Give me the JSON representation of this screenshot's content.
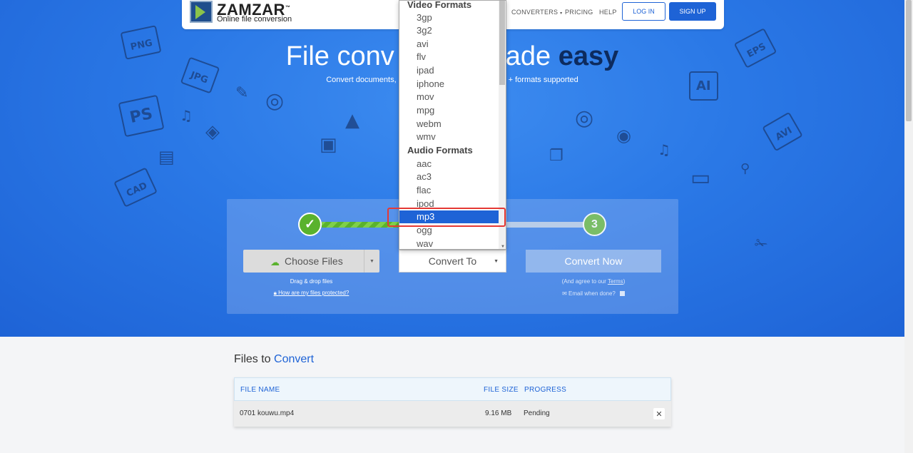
{
  "nav": {
    "logo_name": "ZAMZAR",
    "logo_tm": "™",
    "logo_tagline": "Online file conversion",
    "converters": "CONVERTERS",
    "pricing": "PRICING",
    "help": "HELP",
    "login": "LOG IN",
    "signup": "SIGN UP"
  },
  "hero": {
    "headline_start": "File conv",
    "headline_mid": "ade ",
    "headline_bold": "easy",
    "sub_left": "Convert documents,",
    "sub_right": "+ formats supported"
  },
  "doodles": [
    "PNG",
    "JPG",
    "PS",
    "CAD",
    "EPS",
    "AI",
    "AVI"
  ],
  "converter": {
    "step1_mark": "✓",
    "step3_number": "3",
    "choose_files": "Choose Files",
    "drag_drop": "Drag & drop files",
    "protected_link": "How are my files protected?",
    "convert_to": "Convert To",
    "convert_now": "Convert Now",
    "agree_prefix": "(And agree to our ",
    "agree_link": "Terms",
    "agree_suffix": ")",
    "email_done": "Email when done?"
  },
  "dropdown": {
    "video_group": "Video Formats",
    "video_items": [
      "3gp",
      "3g2",
      "avi",
      "flv",
      "ipad",
      "iphone",
      "mov",
      "mpg",
      "webm",
      "wmv"
    ],
    "audio_group": "Audio Formats",
    "audio_items": [
      "aac",
      "ac3",
      "flac",
      "ipod",
      "mp3",
      "ogg",
      "wav"
    ],
    "selected": "mp3"
  },
  "files": {
    "title_start": "Files to ",
    "title_accent": "Convert",
    "col_name": "FILE NAME",
    "col_size": "FILE SIZE",
    "col_progress": "PROGRESS",
    "row": {
      "name": "0701 kouwu.mp4",
      "size": "9.16 MB",
      "progress": "Pending"
    }
  },
  "colors": {
    "brand_blue": "#1e63d6",
    "success_green": "#5ab22d",
    "highlight_red": "#e53935"
  }
}
